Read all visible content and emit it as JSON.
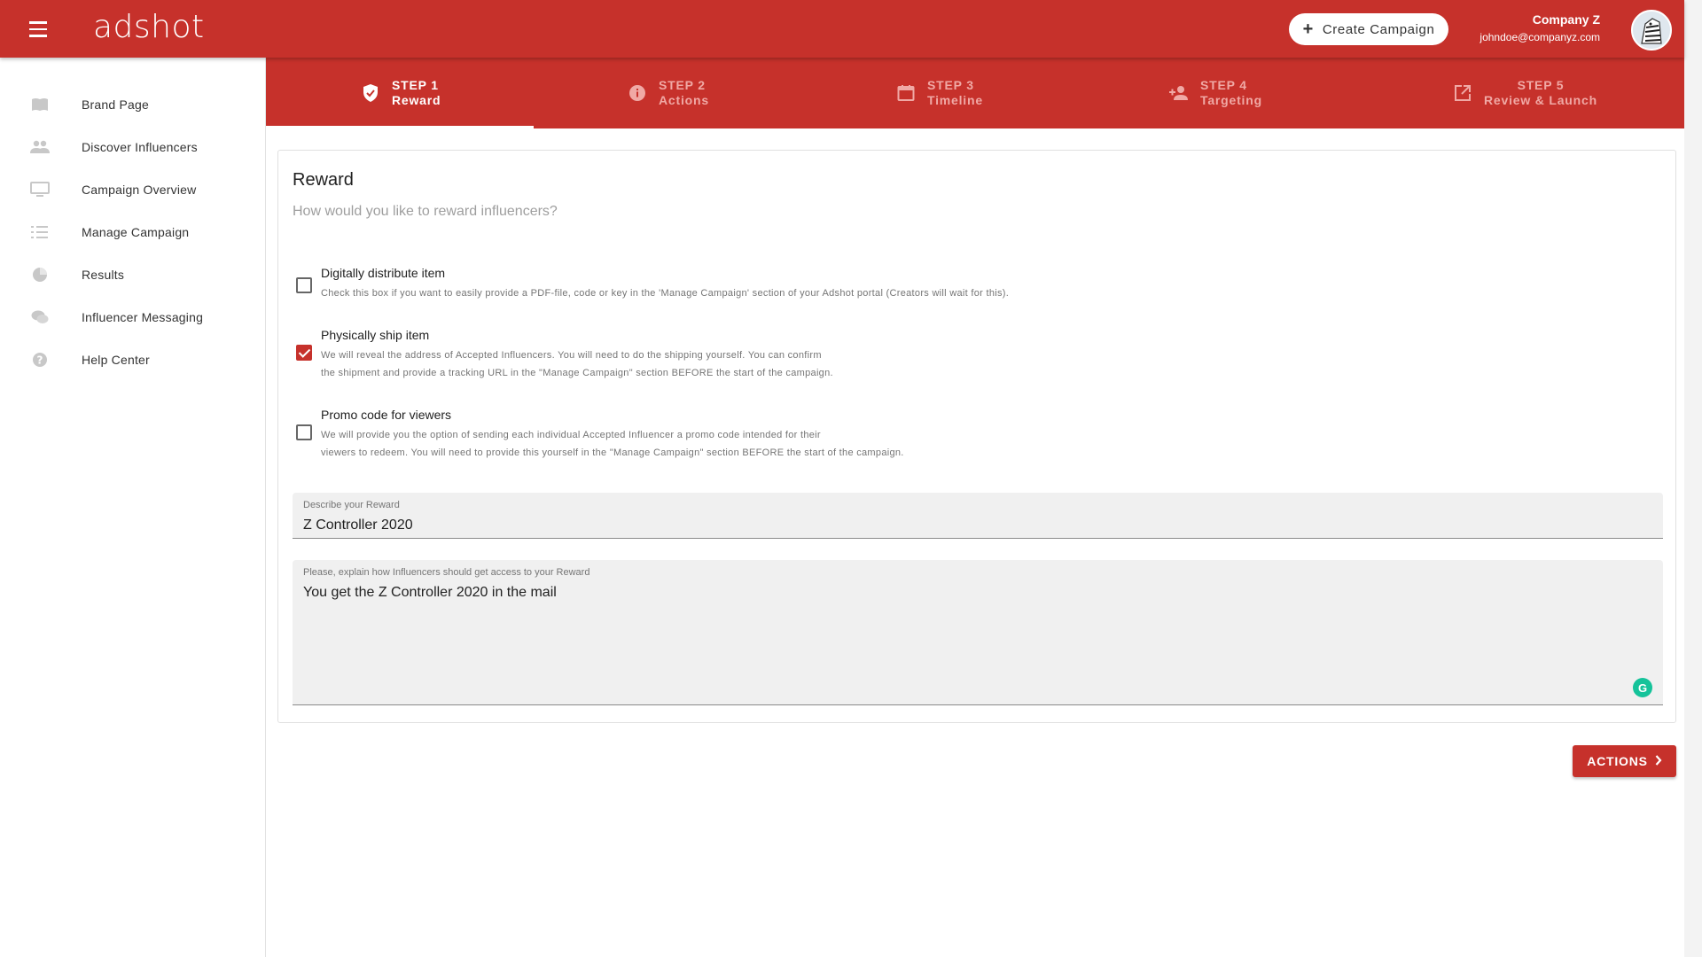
{
  "app": {
    "logo": "adshot"
  },
  "header": {
    "create_label": "Create Campaign",
    "company": "Company Z",
    "email": "johndoe@companyz.com"
  },
  "sidebar": {
    "items": [
      {
        "label": "Brand Page",
        "icon": "book-icon"
      },
      {
        "label": "Discover Influencers",
        "icon": "people-icon"
      },
      {
        "label": "Campaign Overview",
        "icon": "monitor-icon"
      },
      {
        "label": "Manage Campaign",
        "icon": "checklist-icon"
      },
      {
        "label": "Results",
        "icon": "pie-chart-icon"
      },
      {
        "label": "Influencer Messaging",
        "icon": "chat-bubbles-icon"
      },
      {
        "label": "Help Center",
        "icon": "help-icon"
      }
    ]
  },
  "stepper": {
    "steps": [
      {
        "step": "STEP 1",
        "name": "Reward",
        "icon": "shield-check-icon",
        "active": true
      },
      {
        "step": "STEP 2",
        "name": "Actions",
        "icon": "info-icon",
        "active": false
      },
      {
        "step": "STEP 3",
        "name": "Timeline",
        "icon": "calendar-icon",
        "active": false
      },
      {
        "step": "STEP 4",
        "name": "Targeting",
        "icon": "person-add-icon",
        "active": false
      },
      {
        "step": "STEP 5",
        "name": "Review & Launch",
        "icon": "open-external-icon",
        "active": false
      }
    ]
  },
  "reward": {
    "title": "Reward",
    "subtitle": "How would you like to reward influencers?",
    "options": [
      {
        "title": "Digitally distribute item",
        "desc1": "Check this box if you want to easily provide a PDF-file, code or key in the 'Manage Campaign' section of your Adshot portal (Creators will wait for this).",
        "desc2": "",
        "checked": false
      },
      {
        "title": "Physically ship item",
        "desc1": "We will reveal the address of Accepted Influencers. You will need to do the shipping yourself. You can confirm",
        "desc2": "the shipment and provide a tracking URL in the \"Manage Campaign\" section BEFORE the start of the campaign.",
        "checked": true
      },
      {
        "title": "Promo code for viewers",
        "desc1": "We will provide you the option of sending each individual Accepted Influencer a promo code intended for their",
        "desc2": "viewers to redeem. You will need to provide this yourself in the \"Manage Campaign\" section BEFORE the start of the campaign.",
        "checked": false
      }
    ],
    "describe_label": "Describe your Reward",
    "describe_value": "Z Controller 2020",
    "explain_label": "Please, explain how Influencers should get access to your Reward",
    "explain_value": "You get the Z Controller 2020 in the mail"
  },
  "footer": {
    "next_label": "ACTIONS"
  },
  "colors": {
    "brand": "#c6312b",
    "grammarly": "#15c39a"
  }
}
